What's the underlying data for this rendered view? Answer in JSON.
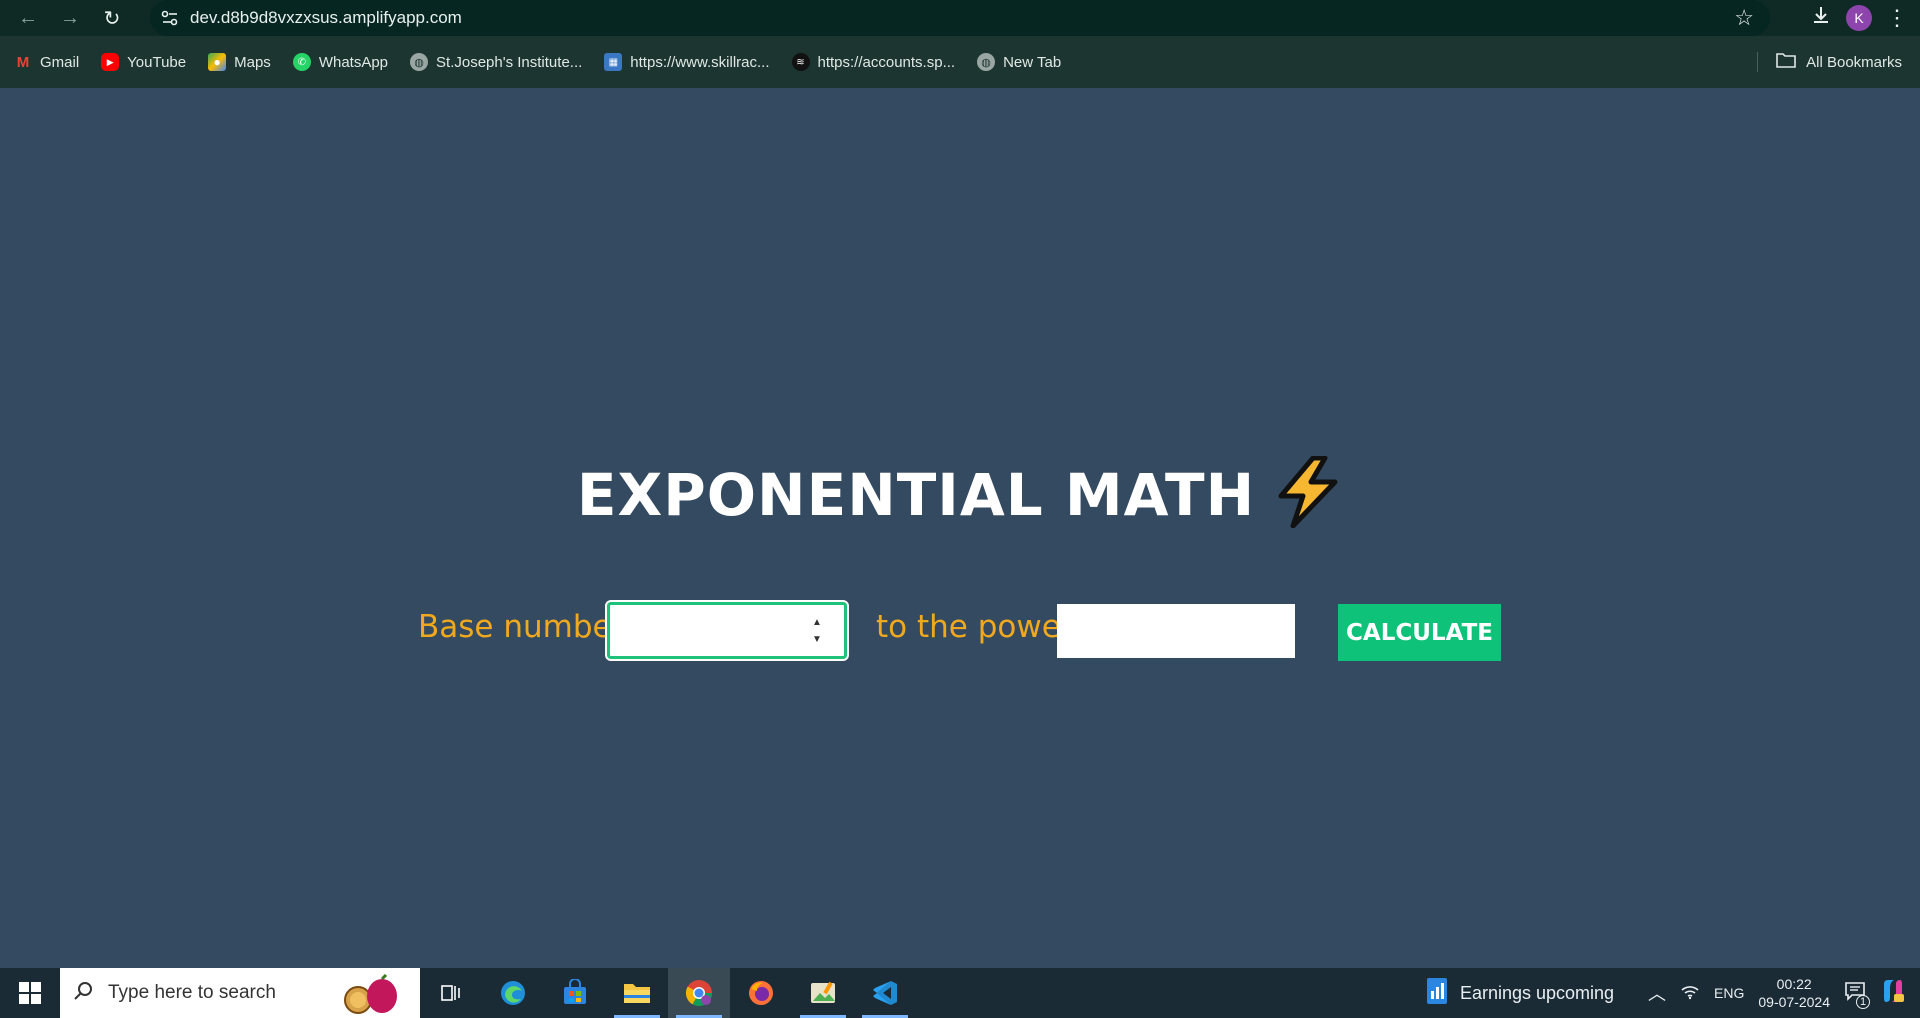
{
  "browser": {
    "url": "dev.d8b9d8vxzxsus.amplifyapp.com",
    "avatar_letter": "K",
    "bookmarks": [
      {
        "label": "Gmail",
        "icon": "gmail-icon"
      },
      {
        "label": "YouTube",
        "icon": "youtube-icon"
      },
      {
        "label": "Maps",
        "icon": "maps-icon"
      },
      {
        "label": "WhatsApp",
        "icon": "whatsapp-icon"
      },
      {
        "label": "St.Joseph's Institute...",
        "icon": "globe-icon"
      },
      {
        "label": "https://www.skillrac...",
        "icon": "skillrack-icon"
      },
      {
        "label": "https://accounts.sp...",
        "icon": "spotify-icon"
      },
      {
        "label": "New Tab",
        "icon": "globe-icon"
      }
    ],
    "all_bookmarks_label": "All Bookmarks"
  },
  "page": {
    "title": "EXPONENTIAL MATH",
    "base_label": "Base number:",
    "power_label": "to the power",
    "base_value": "",
    "power_value": "",
    "calculate_label": "CALCULATE"
  },
  "taskbar": {
    "search_placeholder": "Type here to search",
    "news_text": "Earnings upcoming",
    "language": "ENG",
    "time": "00:22",
    "date": "09-07-2024",
    "notification_count": "1"
  },
  "colors": {
    "page_bg": "#344a61",
    "label": "#f0a81f",
    "button": "#0fc27a",
    "title": "#ffffff"
  }
}
